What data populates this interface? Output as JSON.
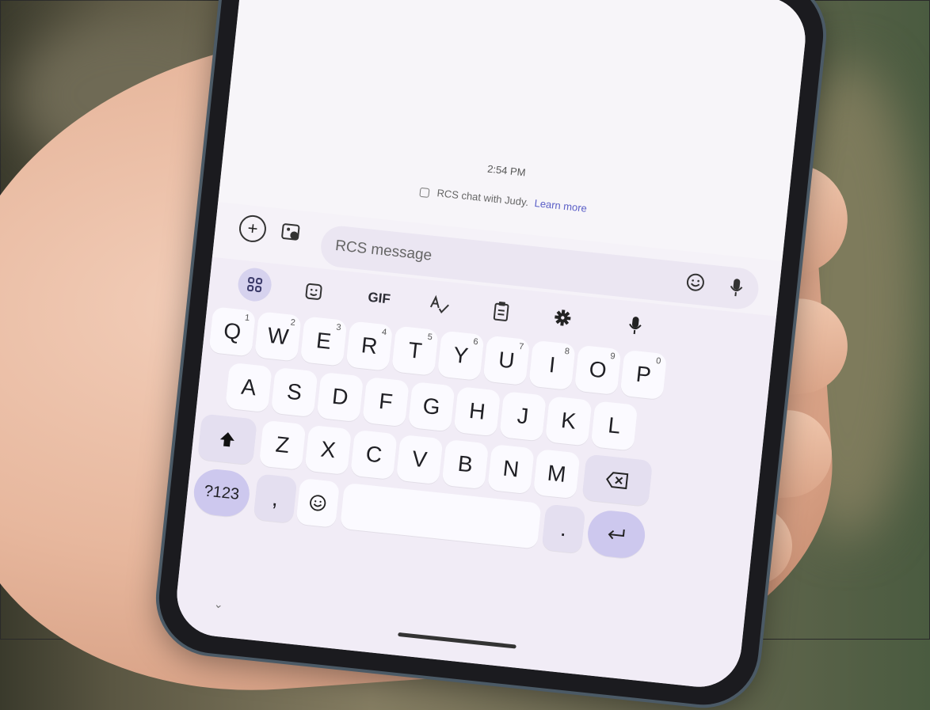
{
  "chat": {
    "timestamp": "2:54 PM",
    "rcs_notice": "RCS chat with Judy.",
    "learn_more": "Learn more"
  },
  "compose": {
    "add_icon": "plus-circle-icon",
    "gallery_icon": "gallery-icon",
    "message_placeholder": "RCS message",
    "emoji_icon": "emoji-icon",
    "mic_icon": "mic-icon"
  },
  "keyboard_toolbar": {
    "apps_icon": "apps-grid-icon",
    "sticker_icon": "sticker-icon",
    "gif_label": "GIF",
    "spellcheck_icon": "spellcheck-icon",
    "clipboard_icon": "clipboard-icon",
    "settings_icon": "gear-icon",
    "voice_icon": "mic-icon"
  },
  "keyboard": {
    "row1": [
      {
        "key": "Q",
        "hint": "1"
      },
      {
        "key": "W",
        "hint": "2"
      },
      {
        "key": "E",
        "hint": "3"
      },
      {
        "key": "R",
        "hint": "4"
      },
      {
        "key": "T",
        "hint": "5"
      },
      {
        "key": "Y",
        "hint": "6"
      },
      {
        "key": "U",
        "hint": "7"
      },
      {
        "key": "I",
        "hint": "8"
      },
      {
        "key": "O",
        "hint": "9"
      },
      {
        "key": "P",
        "hint": "0"
      }
    ],
    "row2": [
      "A",
      "S",
      "D",
      "F",
      "G",
      "H",
      "J",
      "K",
      "L"
    ],
    "row3": [
      "Z",
      "X",
      "C",
      "V",
      "B",
      "N",
      "M"
    ],
    "symbols_label": "?123",
    "comma_label": ",",
    "period_label": ".",
    "shift_icon": "shift-icon",
    "backspace_icon": "backspace-icon",
    "enter_icon": "enter-icon",
    "emoji_icon": "emoji-icon",
    "hide_keyboard_icon": "chevron-down-icon"
  }
}
